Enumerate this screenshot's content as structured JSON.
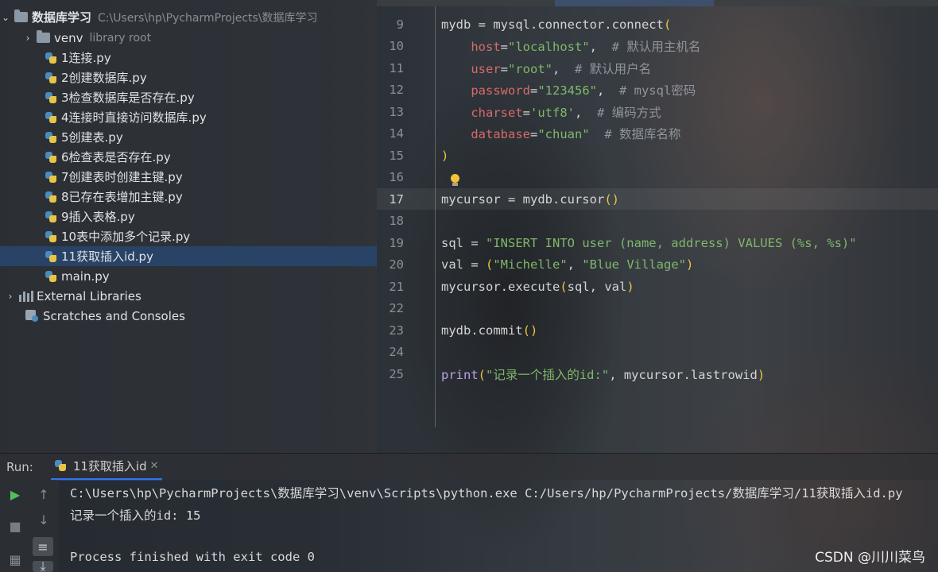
{
  "project": {
    "root": {
      "label": "数据库学习",
      "path": "C:\\Users\\hp\\PycharmProjects\\数据库学习"
    },
    "venv": {
      "label": "venv",
      "hint": "library root"
    },
    "files": [
      "1连接.py",
      "2创建数据库.py",
      "3检查数据库是否存在.py",
      "4连接时直接访问数据库.py",
      "5创建表.py",
      "6检查表是否存在.py",
      "7创建表时创建主键.py",
      "8已存在表增加主键.py",
      "9插入表格.py",
      "10表中添加多个记录.py",
      "11获取插入id.py",
      "main.py"
    ],
    "selected_file": "11获取插入id.py",
    "external_libraries": "External Libraries",
    "scratches": "Scratches and Consoles"
  },
  "editor": {
    "current_line": "17",
    "lines": [
      {
        "no": "9",
        "text": "mydb = mysql.connector.connect("
      },
      {
        "no": "10",
        "text": "    host=\"localhost\",  # 默认用主机名"
      },
      {
        "no": "11",
        "text": "    user=\"root\",  # 默认用户名"
      },
      {
        "no": "12",
        "text": "    password=\"123456\",  # mysql密码"
      },
      {
        "no": "13",
        "text": "    charset='utf8',  # 编码方式"
      },
      {
        "no": "14",
        "text": "    database=\"chuan\"  # 数据库名称"
      },
      {
        "no": "15",
        "text": ")"
      },
      {
        "no": "16",
        "text": ""
      },
      {
        "no": "17",
        "text": "mycursor = mydb.cursor()"
      },
      {
        "no": "18",
        "text": ""
      },
      {
        "no": "19",
        "text": "sql = \"INSERT INTO user (name, address) VALUES (%s, %s)\""
      },
      {
        "no": "20",
        "text": "val = (\"Michelle\", \"Blue Village\")"
      },
      {
        "no": "21",
        "text": "mycursor.execute(sql, val)"
      },
      {
        "no": "22",
        "text": ""
      },
      {
        "no": "23",
        "text": "mydb.commit()"
      },
      {
        "no": "24",
        "text": ""
      },
      {
        "no": "25",
        "text": "print(\"记录一个插入的id:\", mycursor.lastrowid)"
      }
    ]
  },
  "run": {
    "label": "Run:",
    "tab_label": "11获取插入id",
    "output": [
      "C:\\Users\\hp\\PycharmProjects\\数据库学习\\venv\\Scripts\\python.exe C:/Users/hp/PycharmProjects/数据库学习/11获取插入id.py",
      "记录一个插入的id: 15",
      "",
      "Process finished with exit code 0"
    ]
  },
  "watermark": "CSDN @川川菜鸟",
  "colors": {
    "selection": "#284670",
    "string": "#7fb86a",
    "keyword_param": "#d76a6a",
    "comment": "#8f959c",
    "builtin": "#b9a3e0",
    "run_green": "#4fbf5a",
    "tab_underline": "#3574f0"
  }
}
